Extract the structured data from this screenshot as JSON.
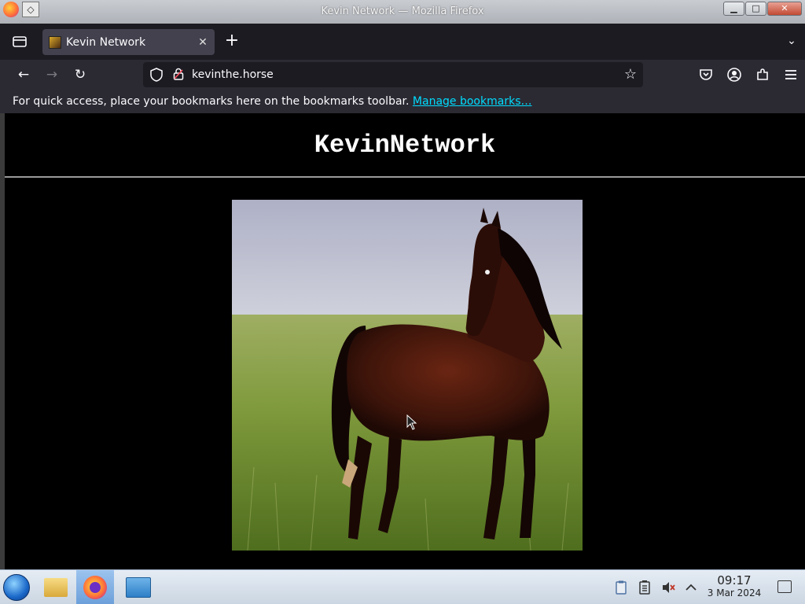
{
  "window": {
    "title": "Kevin Network — Mozilla Firefox",
    "controls": {
      "minimize": "▁",
      "maximize": "□",
      "close": "✕"
    }
  },
  "tabs": [
    {
      "label": "Kevin Network",
      "active": true,
      "close": "✕"
    }
  ],
  "newtab_label": "+",
  "navbar": {
    "back": "←",
    "forward": "→",
    "reload": "↻",
    "url": "kevinthe.horse",
    "bookmark_star": "☆"
  },
  "bookmarks_bar": {
    "text": "For quick access, place your bookmarks here on the bookmarks toolbar.",
    "link": "Manage bookmarks…"
  },
  "page": {
    "site_title": "KevinNetwork",
    "background": "#000000"
  },
  "taskbar": {
    "time": "09:17",
    "date": "3 Mar 2024",
    "tray_icons": [
      "clipboard-icon",
      "battery-icon",
      "volume-muted-icon",
      "chevron-up-icon"
    ],
    "launchers": [
      "start-menu-icon",
      "file-manager-icon",
      "firefox-icon",
      "system-monitor-icon"
    ]
  },
  "colors": {
    "accent_link": "#00ddff",
    "toolbar": "#2b2a33",
    "tabstrip": "#1c1b22"
  }
}
